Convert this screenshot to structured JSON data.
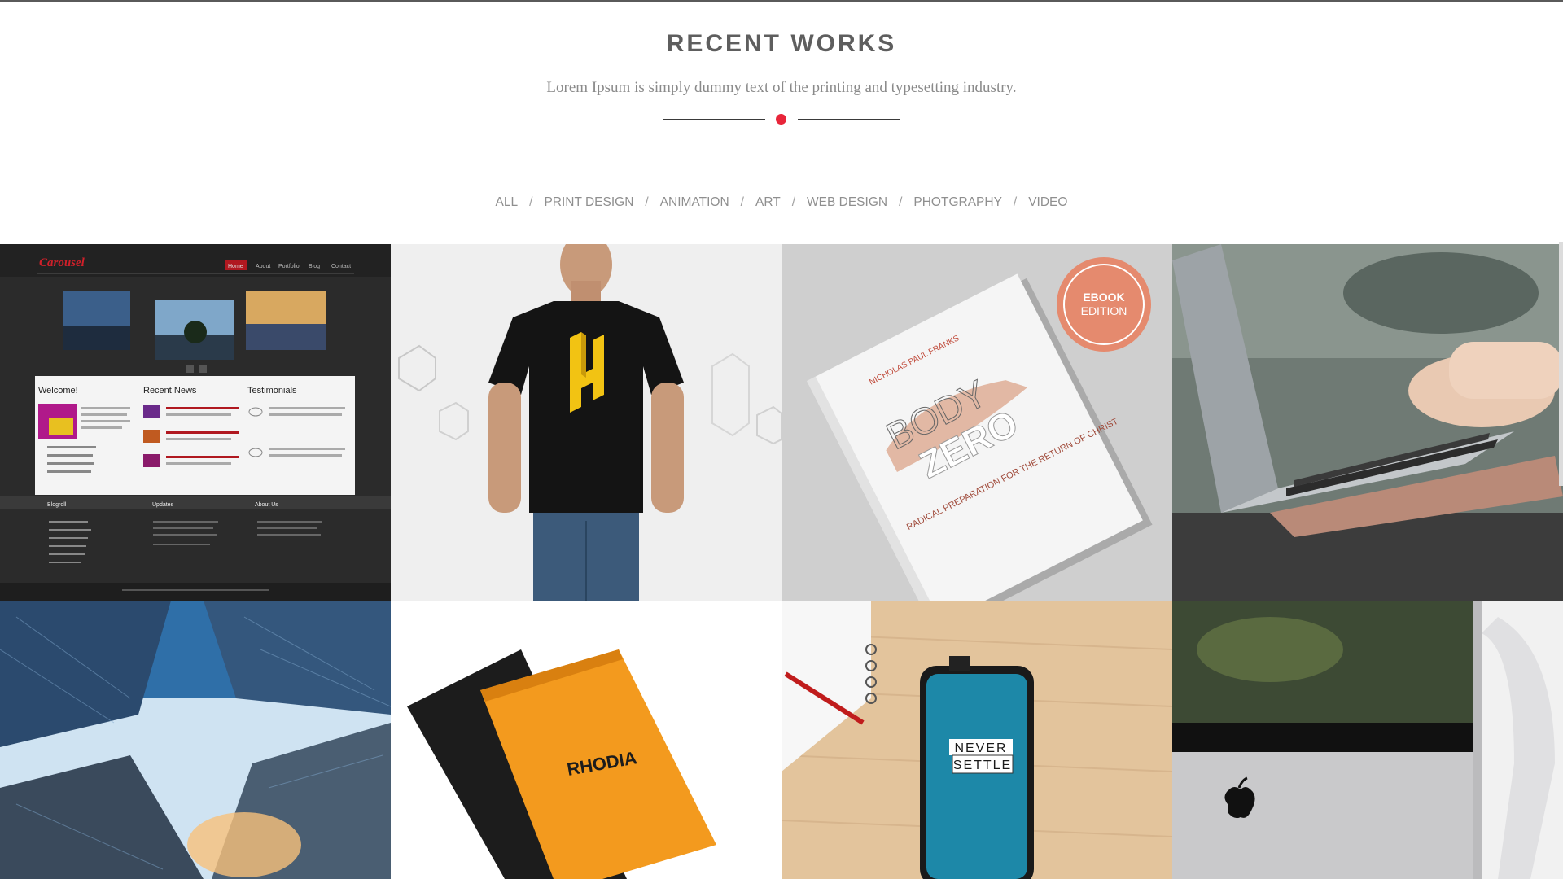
{
  "section": {
    "title": "RECENT WORKS",
    "subtitle": "Lorem Ipsum is simply dummy text of the printing and typesetting industry.",
    "accent_color": "#e8253a"
  },
  "filters": [
    "ALL",
    "PRINT DESIGN",
    "ANIMATION",
    "ART",
    "WEB DESIGN",
    "PHOTGRAPHY",
    "VIDEO"
  ],
  "portfolio": {
    "website_mock": {
      "logo": "Carousel",
      "nav": [
        "Home",
        "About",
        "Portfolio",
        "Blog",
        "Contact"
      ],
      "col1_title": "Welcome!",
      "col2_title": "Recent News",
      "col3_title": "Testimonials",
      "footer1": "Blogroll",
      "footer2": "Updates",
      "footer3": "About Us"
    },
    "ebook": {
      "badge_line1": "EBOOK",
      "badge_line2": "EDITION",
      "author": "NICHOLAS PAUL FRANKS",
      "title_line1": "BODY",
      "title_line2": "ZERO",
      "tagline": "RADICAL PREPARATION FOR THE RETURN OF CHRIST"
    },
    "notepad_brand": "RHODIA",
    "phone_text_line1": "NEVER",
    "phone_text_line2": "SETTLE"
  }
}
